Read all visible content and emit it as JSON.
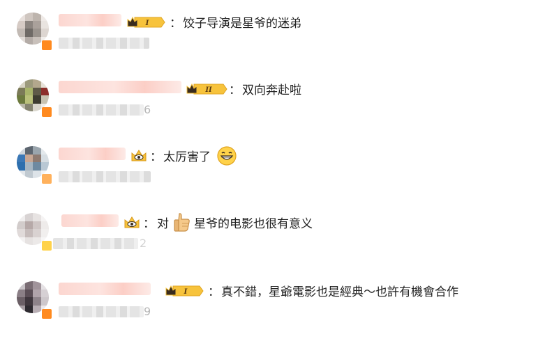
{
  "comments": [
    {
      "badge_level": "I",
      "text": "饺子导演是星爷的迷弟",
      "meta_tail": ""
    },
    {
      "badge_level": "II",
      "text": "双向奔赴啦",
      "meta_tail": "6"
    },
    {
      "badge_level": "",
      "text": "太厉害了",
      "meta_tail": ""
    },
    {
      "badge_level": "",
      "text_before": "对",
      "text": "星爷的电影也很有意义",
      "meta_tail": "2"
    },
    {
      "badge_level": "I",
      "text": "真不錯，星爺電影也是經典～也許有機會合作",
      "meta_tail": "9"
    }
  ],
  "colors": {
    "text": "#222222",
    "crown_gold": "#f7c33c",
    "crown_dark": "#3a2c1e",
    "vip_orange": "#ff8a1f"
  },
  "icons": [
    "crown-level-badge",
    "crown-eye-badge",
    "grinning-face-emoji",
    "thumbs-up-emoji"
  ]
}
